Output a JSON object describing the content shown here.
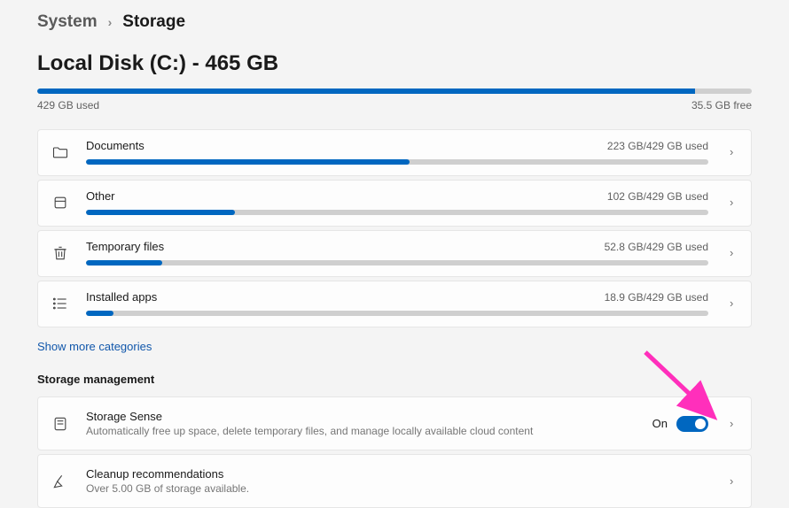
{
  "breadcrumb": {
    "parent": "System",
    "current": "Storage"
  },
  "disk": {
    "title": "Local Disk (C:) - 465 GB",
    "used_pct": 92,
    "used_label": "429 GB used",
    "free_label": "35.5 GB free"
  },
  "categories": [
    {
      "icon": "folder",
      "name": "Documents",
      "usage": "223 GB/429 GB used",
      "pct": 52
    },
    {
      "icon": "box",
      "name": "Other",
      "usage": "102 GB/429 GB used",
      "pct": 24
    },
    {
      "icon": "trash",
      "name": "Temporary files",
      "usage": "52.8 GB/429 GB used",
      "pct": 12.3
    },
    {
      "icon": "list",
      "name": "Installed apps",
      "usage": "18.9 GB/429 GB used",
      "pct": 4.4
    }
  ],
  "show_more": "Show more categories",
  "mgmt_heading": "Storage management",
  "storage_sense": {
    "title": "Storage Sense",
    "subtitle": "Automatically free up space, delete temporary files, and manage locally available cloud content",
    "state_label": "On"
  },
  "cleanup": {
    "title": "Cleanup recommendations",
    "subtitle": "Over 5.00 GB of storage available."
  }
}
